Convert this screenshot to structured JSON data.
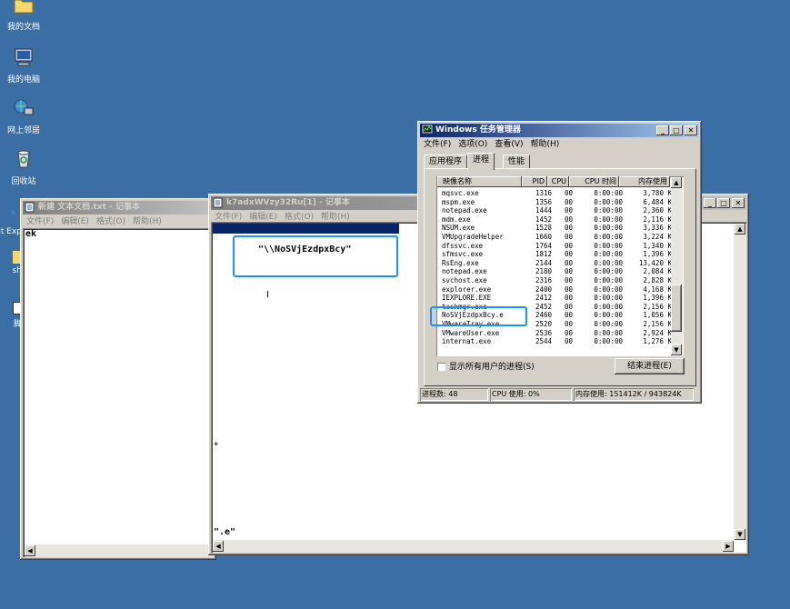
{
  "desktop": {
    "icons": [
      {
        "label": "我的文档",
        "icon": "folder-icon"
      },
      {
        "label": "我的电脑",
        "icon": "computer-icon"
      },
      {
        "label": "网上邻居",
        "icon": "network-icon"
      },
      {
        "label": "回收站",
        "icon": "recycle-bin-icon"
      },
      {
        "label": "Int Exp",
        "icon": "ie-icon"
      },
      {
        "label": "sh",
        "icon": "shortcut-icon"
      },
      {
        "label": "脚",
        "icon": "script-icon"
      }
    ]
  },
  "notepad1": {
    "title": "新建 文本文档.txt - 记事本",
    "menu": [
      "文件(F)",
      "编辑(E)",
      "格式(O)",
      "帮助(H)"
    ],
    "content": "ek"
  },
  "notepad2": {
    "title": "k7adxWVzy32Ru[1] - 记事本",
    "menu": [
      "文件(F)",
      "编辑(E)",
      "格式(O)",
      "帮助(H)"
    ],
    "highlighted_text": "\"\\\\NoSVjEzdpxBcy\"",
    "mark": "+",
    "bottom_text": "\".e\""
  },
  "taskmgr": {
    "title": "Windows 任务管理器",
    "menu": [
      "文件(F)",
      "选项(O)",
      "查看(V)",
      "帮助(H)"
    ],
    "tabs": [
      "应用程序",
      "进程",
      "性能"
    ],
    "columns": [
      "映像名称",
      "PID",
      "CPU",
      "CPU 时间",
      "内存使用"
    ],
    "processes": [
      {
        "name": "mqsvc.exe",
        "pid": "1316",
        "cpu": "00",
        "time": "0:00:00",
        "mem": "3,780 K"
      },
      {
        "name": "mspm.exe",
        "pid": "1356",
        "cpu": "00",
        "time": "0:00:00",
        "mem": "6,484 K"
      },
      {
        "name": "notepad.exe",
        "pid": "1444",
        "cpu": "00",
        "time": "0:00:00",
        "mem": "2,360 K"
      },
      {
        "name": "mdm.exe",
        "pid": "1452",
        "cpu": "00",
        "time": "0:00:00",
        "mem": "2,116 K"
      },
      {
        "name": "NSUM.exe",
        "pid": "1528",
        "cpu": "00",
        "time": "0:00:00",
        "mem": "3,336 K"
      },
      {
        "name": "VMUpgradeHelper",
        "pid": "1660",
        "cpu": "00",
        "time": "0:00:00",
        "mem": "3,224 K"
      },
      {
        "name": "dfssvc.exe",
        "pid": "1764",
        "cpu": "00",
        "time": "0:00:00",
        "mem": "1,340 K"
      },
      {
        "name": "sfmsvc.exe",
        "pid": "1812",
        "cpu": "00",
        "time": "0:00:00",
        "mem": "1,396 K"
      },
      {
        "name": "RsEng.exe",
        "pid": "2144",
        "cpu": "00",
        "time": "0:00:00",
        "mem": "13,420 K"
      },
      {
        "name": "notepad.exe",
        "pid": "2180",
        "cpu": "00",
        "time": "0:00:00",
        "mem": "2,084 K"
      },
      {
        "name": "svchost.exe",
        "pid": "2316",
        "cpu": "00",
        "time": "0:00:00",
        "mem": "2,828 K"
      },
      {
        "name": "explorer.exe",
        "pid": "2400",
        "cpu": "00",
        "time": "0:00:00",
        "mem": "4,168 K"
      },
      {
        "name": "IEXPLORE.EXE",
        "pid": "2412",
        "cpu": "00",
        "time": "0:00:00",
        "mem": "1,396 K"
      },
      {
        "name": "taskmgr.exe",
        "pid": "2452",
        "cpu": "00",
        "time": "0:00:00",
        "mem": "2,156 K"
      },
      {
        "name": "NoSVjEzdpxBcy.e",
        "pid": "2460",
        "cpu": "00",
        "time": "0:00:00",
        "mem": "1,056 K"
      },
      {
        "name": "VMwareTray.exe",
        "pid": "2520",
        "cpu": "00",
        "time": "0:00:00",
        "mem": "2,156 K"
      },
      {
        "name": "VMwareUser.exe",
        "pid": "2536",
        "cpu": "00",
        "time": "0:00:00",
        "mem": "2,924 K"
      },
      {
        "name": "internat.exe",
        "pid": "2544",
        "cpu": "00",
        "time": "0:00:00",
        "mem": "1,276 K"
      }
    ],
    "show_all_users": "显示所有用户的进程(S)",
    "end_process": "结束进程(E)",
    "status": {
      "processes": "进程数: 48",
      "cpu": "CPU 使用: 0%",
      "memory": "内存使用: 151412K / 943824K"
    }
  },
  "colors": {
    "desktop": "#3a6ea5",
    "title_active": "#0a246a",
    "highlight": "#1e90ff",
    "selection": "#0a246a"
  }
}
